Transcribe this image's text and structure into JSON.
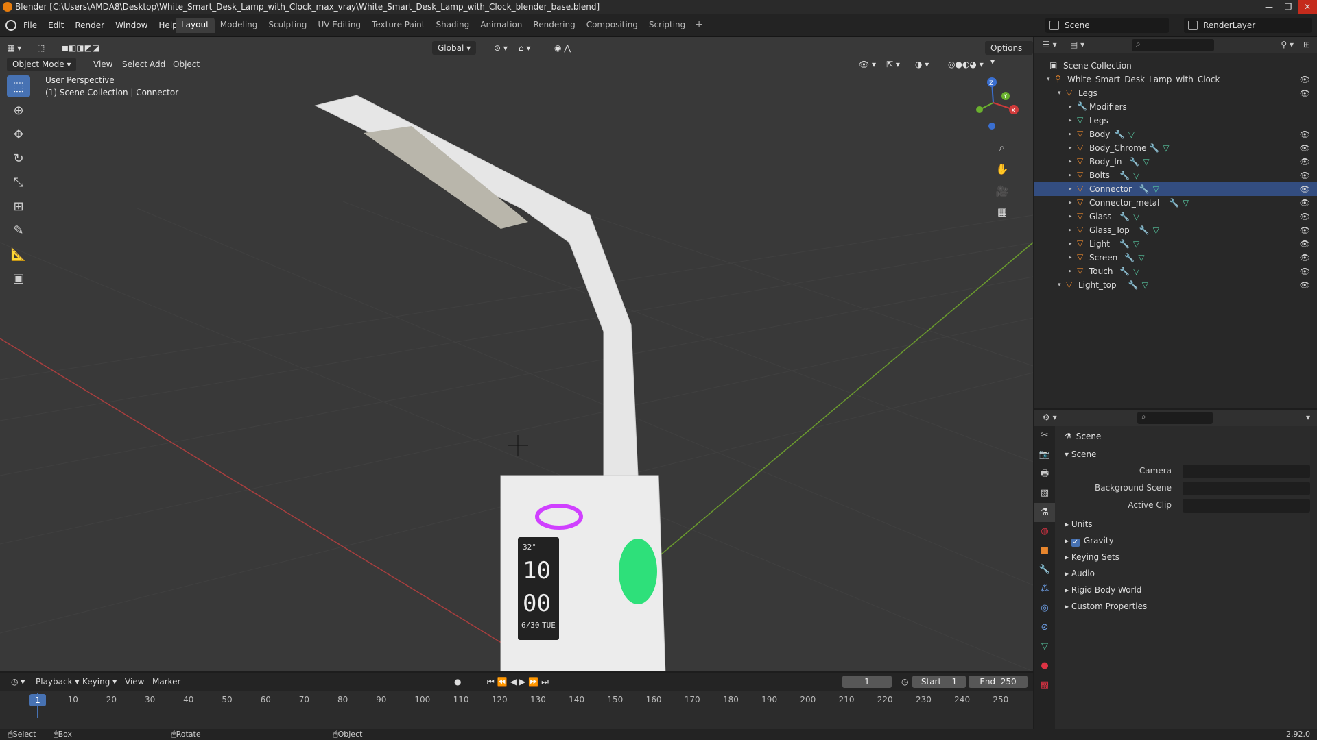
{
  "window": {
    "title": "Blender [C:\\Users\\AMDA8\\Desktop\\White_Smart_Desk_Lamp_with_Clock_max_vray\\White_Smart_Desk_Lamp_with_Clock_blender_base.blend]",
    "controls": [
      "—",
      "❐",
      "✕"
    ]
  },
  "menubar": [
    "File",
    "Edit",
    "Render",
    "Window",
    "Help"
  ],
  "workspaces": [
    {
      "label": "Layout",
      "active": true
    },
    {
      "label": "Modeling"
    },
    {
      "label": "Sculpting"
    },
    {
      "label": "UV Editing"
    },
    {
      "label": "Texture Paint"
    },
    {
      "label": "Shading"
    },
    {
      "label": "Animation"
    },
    {
      "label": "Rendering"
    },
    {
      "label": "Compositing"
    },
    {
      "label": "Scripting"
    }
  ],
  "scene_selector": "Scene",
  "renderlayer_selector": "RenderLayer",
  "viewport": {
    "mode": "Object Mode",
    "menus": [
      "View",
      "Select",
      "Add",
      "Object"
    ],
    "orientation": "Global",
    "options": "Options",
    "info_line1": "User Perspective",
    "info_line2": "(1) Scene Collection | Connector",
    "gizmo_axes": [
      "Z",
      "Y",
      "X"
    ],
    "tools": [
      "select-box",
      "cursor",
      "move",
      "rotate",
      "scale",
      "transform",
      "annotate",
      "measure",
      "add-cube"
    ]
  },
  "outliner": {
    "root": "Scene Collection",
    "items": [
      {
        "label": "White_Smart_Desk_Lamp_with_Clock",
        "depth": 1,
        "icon": "armature-icon",
        "eye": true,
        "mods": false
      },
      {
        "label": "Legs",
        "depth": 2,
        "icon": "object-icon",
        "eye": true,
        "mods": false
      },
      {
        "label": "Modifiers",
        "depth": 3,
        "icon": "wrench-icon",
        "eye": false,
        "mods": false
      },
      {
        "label": "Legs",
        "depth": 3,
        "icon": "mesh-icon",
        "eye": false,
        "mods": false
      },
      {
        "label": "Body",
        "depth": 3,
        "icon": "object-icon",
        "eye": true,
        "mods": true
      },
      {
        "label": "Body_Chrome",
        "depth": 3,
        "icon": "object-icon",
        "eye": true,
        "mods": true
      },
      {
        "label": "Body_In",
        "depth": 3,
        "icon": "object-icon",
        "eye": true,
        "mods": true
      },
      {
        "label": "Bolts",
        "depth": 3,
        "icon": "object-icon",
        "eye": true,
        "mods": true
      },
      {
        "label": "Connector",
        "depth": 3,
        "icon": "object-icon",
        "eye": true,
        "mods": true,
        "selected": true
      },
      {
        "label": "Connector_metal",
        "depth": 3,
        "icon": "object-icon",
        "eye": true,
        "mods": true
      },
      {
        "label": "Glass",
        "depth": 3,
        "icon": "object-icon",
        "eye": true,
        "mods": true
      },
      {
        "label": "Glass_Top",
        "depth": 3,
        "icon": "object-icon",
        "eye": true,
        "mods": true
      },
      {
        "label": "Light",
        "depth": 3,
        "icon": "object-icon",
        "eye": true,
        "mods": true
      },
      {
        "label": "Screen",
        "depth": 3,
        "icon": "object-icon",
        "eye": true,
        "mods": true
      },
      {
        "label": "Touch",
        "depth": 3,
        "icon": "object-icon",
        "eye": true,
        "mods": true
      },
      {
        "label": "Light_top",
        "depth": 2,
        "icon": "object-icon",
        "eye": true,
        "mods": true
      }
    ]
  },
  "properties": {
    "context": "Scene",
    "section": "Scene",
    "fields": [
      {
        "label": "Camera"
      },
      {
        "label": "Background Scene"
      },
      {
        "label": "Active Clip"
      }
    ],
    "panels": [
      {
        "label": "Units",
        "checkbox": false
      },
      {
        "label": "Gravity",
        "checkbox": true
      },
      {
        "label": "Keying Sets",
        "checkbox": false
      },
      {
        "label": "Audio",
        "checkbox": false
      },
      {
        "label": "Rigid Body World",
        "checkbox": false
      },
      {
        "label": "Custom Properties",
        "checkbox": false
      }
    ]
  },
  "timeline": {
    "menus": [
      "Playback",
      "Keying",
      "View",
      "Marker"
    ],
    "current_frame": "1",
    "start_label": "Start",
    "start": "1",
    "end_label": "End",
    "end": "250",
    "ticks": [
      "1",
      "10",
      "20",
      "30",
      "40",
      "50",
      "60",
      "70",
      "80",
      "90",
      "100",
      "110",
      "120",
      "130",
      "140",
      "150",
      "160",
      "170",
      "180",
      "190",
      "200",
      "210",
      "220",
      "230",
      "240",
      "250"
    ]
  },
  "statusbar": {
    "select": "Select",
    "box_select": "Box Select",
    "rotate_view": "Rotate View",
    "context_menu": "Object Context Menu",
    "version": "2.92.0"
  },
  "lamp_display": {
    "temp": "32°",
    "hour": "10",
    "minute": "00",
    "date": "6/30",
    "day": "TUE"
  }
}
